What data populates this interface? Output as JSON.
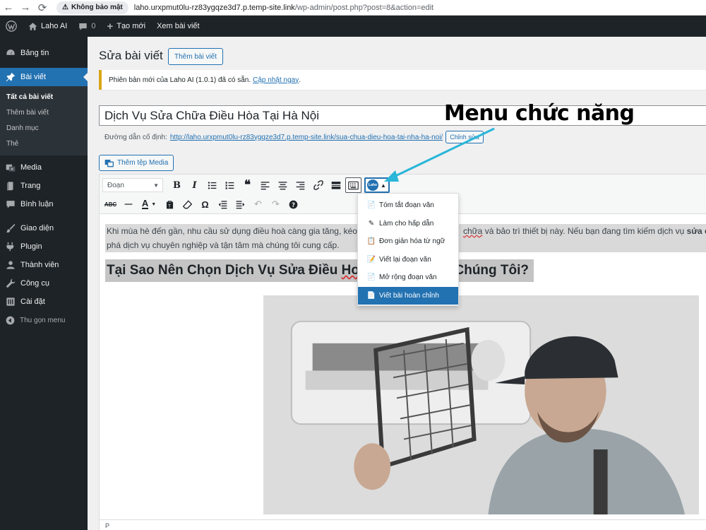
{
  "browser": {
    "security_label": "Không bảo mật",
    "url_host": "laho.urxpmut0lu-rz83ygqze3d7.p.temp-site.link",
    "url_path": "/wp-admin/post.php?post=8&action=edit"
  },
  "admin_bar": {
    "site_name": "Laho AI",
    "comments_count": "0",
    "new_label": "Tạo mới",
    "view_post_label": "Xem bài viết"
  },
  "sidebar": {
    "dashboard": "Bảng tin",
    "posts": "Bài viết",
    "posts_sub": [
      "Tất cả bài viết",
      "Thêm bài viết",
      "Danh mục",
      "Thẻ"
    ],
    "media": "Media",
    "pages": "Trang",
    "comments": "Bình luận",
    "appearance": "Giao diện",
    "plugins": "Plugin",
    "users": "Thành viên",
    "tools": "Công cụ",
    "settings": "Cài đặt",
    "collapse": "Thu gọn menu"
  },
  "page": {
    "title": "Sửa bài viết",
    "add_new_label": "Thêm bài viết",
    "notice_text": "Phiên bản mới của Laho AI (1.0.1) đã có sẵn.",
    "notice_link": "Cập nhật ngay",
    "notice_end": ".",
    "post_title": "Dịch Vụ Sửa Chữa Điều Hòa Tại Hà Nội",
    "permalink_label": "Đường dẫn cố định:",
    "permalink_url": "http://laho.urxpmut0lu-rz83ygqze3d7.p.temp-site.link/sua-chua-dieu-hoa-tai-nha-ha-noi/",
    "edit_slug_label": "Chỉnh sửa",
    "add_media_label": "Thêm tệp Media"
  },
  "editor": {
    "format_value": "Đoạn",
    "paragraph_line1_a": "Khi mùa hè đến gần, nhu cầu sử dụng điều hoà càng gia tăng, kéo",
    "paragraph_line1_b": "chữa",
    "paragraph_line1_c": "và bảo trì thiết bị này. Nếu bạn đang tìm kiếm dịch vụ",
    "paragraph_line1_d": "sửa c",
    "paragraph_line2": "phá dịch vụ chuyên nghiệp và tận tâm mà chúng tôi cung cấp.",
    "heading_a": "Tại Sao Nên Chọn Dịch Vụ Sửa Điều",
    "heading_b": "Hoà",
    "heading_c": "Chúng Tôi?",
    "status_path": "P"
  },
  "dropdown": {
    "items": [
      "Tóm tắt đoạn văn",
      "Làm cho hấp dẫn",
      "Đơn giản hóa từ ngữ",
      "Viết lại đoạn văn",
      "Mở rộng đoạn văn",
      "Viết bài hoàn chỉnh"
    ],
    "icons": [
      "📄",
      "✎",
      "📋",
      "📝",
      "📄",
      "📄"
    ],
    "active_index": 5
  },
  "annotation": {
    "label": "Menu chức năng",
    "arrow_color": "#29b6d8"
  },
  "colors": {
    "accent": "#2271b1",
    "sidebar_bg": "#1d2327",
    "notice_border": "#dba617"
  }
}
